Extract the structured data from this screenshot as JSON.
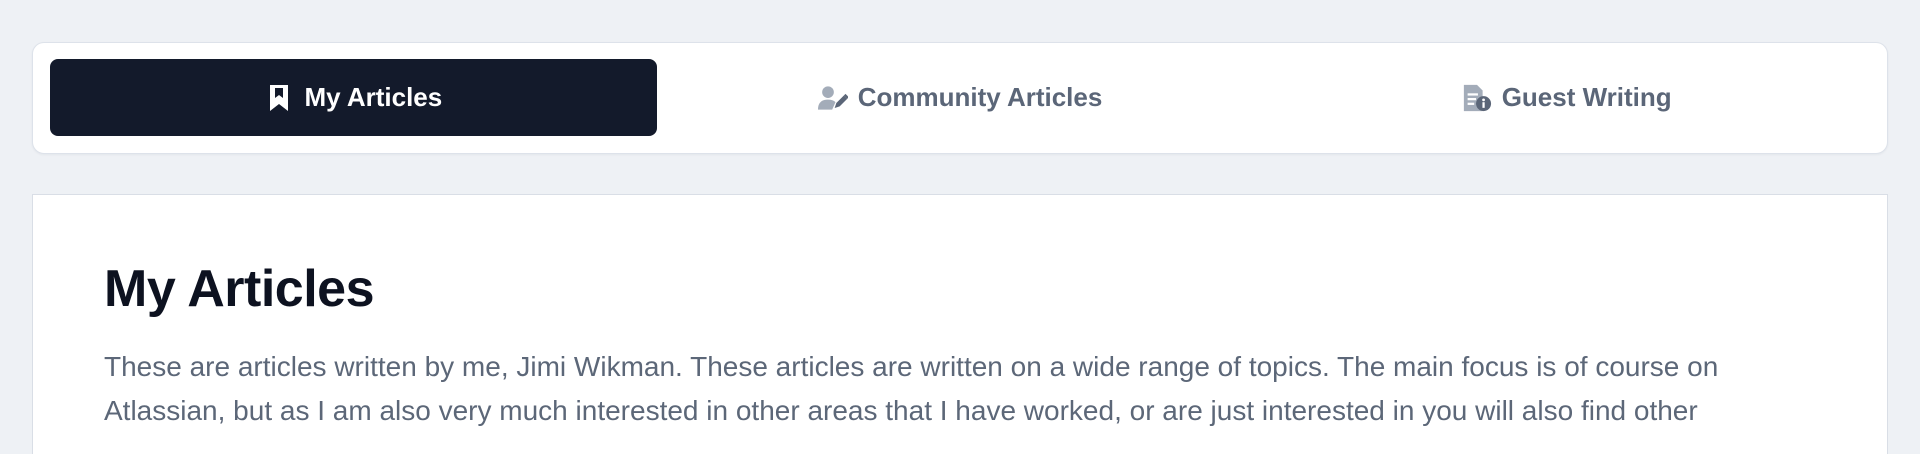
{
  "tabs": [
    {
      "label": "My Articles",
      "icon": "bookmark-icon",
      "active": true
    },
    {
      "label": "Community Articles",
      "icon": "user-pen-icon",
      "active": false
    },
    {
      "label": "Guest Writing",
      "icon": "document-info-icon",
      "active": false
    }
  ],
  "content": {
    "title": "My Articles",
    "description": "These are articles written by me, Jimi Wikman. These articles are written on a wide range of topics. The main focus is of course on Atlassian, but as I am also very much interested in other areas that I have worked, or are just interested in you will also find other"
  },
  "colors": {
    "page_background": "#eef1f5",
    "active_tab": "#131a2b",
    "inactive_text": "#5b6678",
    "inactive_icon": "#a3acb9",
    "heading": "#0d1220",
    "body_text": "#5c6778"
  }
}
